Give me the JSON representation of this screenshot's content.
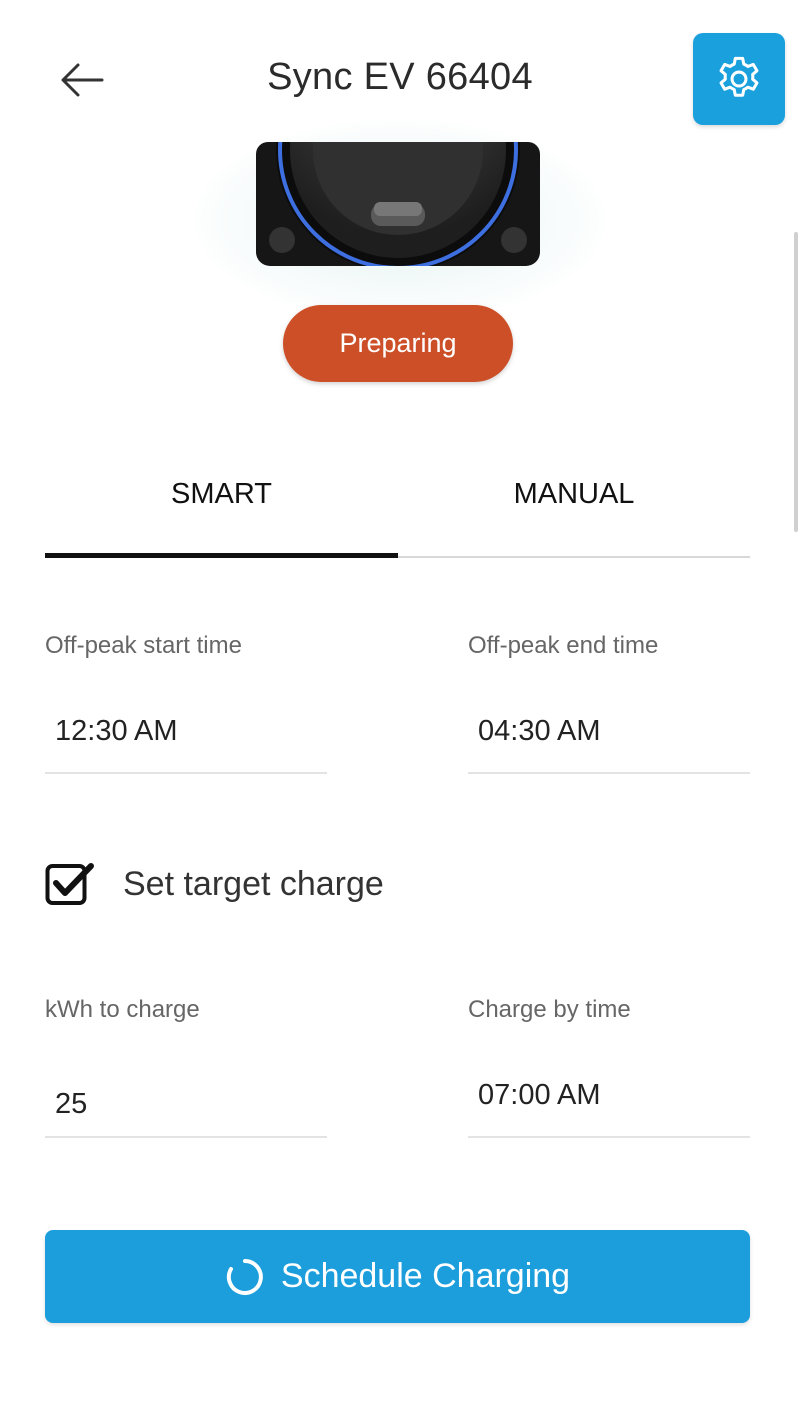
{
  "header": {
    "title": "Sync EV 66404",
    "back_icon": "arrow-left-icon",
    "settings_icon": "gear-icon",
    "accent_color": "#1aa0dd"
  },
  "charger": {
    "image_description_icon": "ev-charger-image",
    "status": "Preparing",
    "status_color": "#cc4f27"
  },
  "tabs": [
    {
      "label": "SMART",
      "active": true
    },
    {
      "label": "MANUAL",
      "active": false
    }
  ],
  "smart": {
    "offpeak_start": {
      "label": "Off-peak start time",
      "value": "12:30 AM"
    },
    "offpeak_end": {
      "label": "Off-peak end time",
      "value": "04:30 AM"
    },
    "target_charge": {
      "label": "Set target charge",
      "checked": true
    },
    "kwh": {
      "label": "kWh to charge",
      "value": "25"
    },
    "charge_by": {
      "label": "Charge by time",
      "value": "07:00 AM"
    }
  },
  "actions": {
    "schedule_label": "Schedule Charging",
    "schedule_icon": "spinner-icon",
    "button_color": "#1c9edc"
  }
}
